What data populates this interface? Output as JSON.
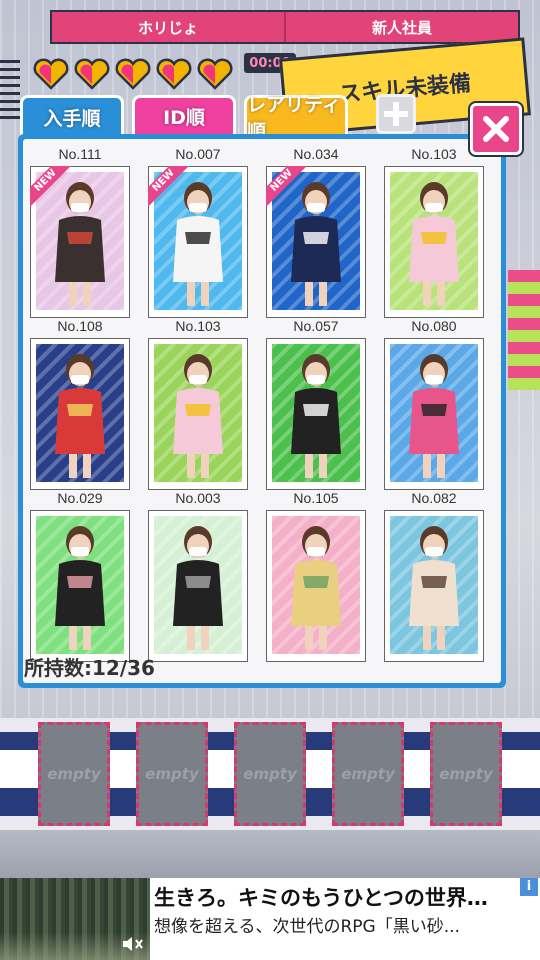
{
  "header": {
    "left_label": "ホリじょ",
    "right_label": "新人社員",
    "timer": "00:00",
    "skill_banner": "スキル未装備",
    "hearts_count": 5
  },
  "tabs": [
    {
      "label": "入手順",
      "color": "#2b8fd8",
      "active": true
    },
    {
      "label": "ID順",
      "color": "#f040a0",
      "active": false
    },
    {
      "label": "レアリティ順",
      "color": "#f8b81e",
      "active": false
    }
  ],
  "cards": [
    {
      "no": "No.111",
      "new": true,
      "bg": "#e8c6e6",
      "outfit": "#3a3030",
      "accent": "#d84a3a"
    },
    {
      "no": "No.007",
      "new": true,
      "bg": "#4fb8ee",
      "outfit": "#f5f5f5",
      "accent": "#222222"
    },
    {
      "no": "No.034",
      "new": true,
      "bg": "#1f66c8",
      "outfit": "#1c2a55",
      "accent": "#ffffff"
    },
    {
      "no": "No.103",
      "new": false,
      "bg": "#b8e27a",
      "outfit": "#f5c9d8",
      "accent": "#f2c11a"
    },
    {
      "no": "No.108",
      "new": false,
      "bg": "#2a3f8a",
      "outfit": "#d83a3a",
      "accent": "#f4d25a"
    },
    {
      "no": "No.103",
      "new": false,
      "bg": "#9ad45a",
      "outfit": "#f5c9d8",
      "accent": "#f2c11a"
    },
    {
      "no": "No.057",
      "new": false,
      "bg": "#4cc04c",
      "outfit": "#222222",
      "accent": "#ffffff"
    },
    {
      "no": "No.080",
      "new": false,
      "bg": "#5aa8e8",
      "outfit": "#e8558a",
      "accent": "#222222"
    },
    {
      "no": "No.029",
      "new": false,
      "bg": "#7ee07e",
      "outfit": "#222222",
      "accent": "#e8a0a8"
    },
    {
      "no": "No.003",
      "new": false,
      "bg": "#d6f0d6",
      "outfit": "#222222",
      "accent": "#a8a8a8"
    },
    {
      "no": "No.105",
      "new": false,
      "bg": "#f4b0c8",
      "outfit": "#e8d080",
      "accent": "#6aa060"
    },
    {
      "no": "No.082",
      "new": false,
      "bg": "#7cc6e0",
      "outfit": "#f0e0d0",
      "accent": "#5a4030"
    }
  ],
  "new_badge": "NEW",
  "owned_count": "所持数:12/36",
  "slots": [
    "empty",
    "empty",
    "empty",
    "empty",
    "empty"
  ],
  "ad": {
    "title": "生きろ。キミのもうひとつの世界…",
    "subtitle": "想像を超える、次世代のRPG「黒い砂...",
    "info": "i"
  },
  "icons": {
    "close": "close-icon",
    "plus": "plus-icon",
    "heart": "heart-icon",
    "mute": "speaker-mute-icon"
  }
}
